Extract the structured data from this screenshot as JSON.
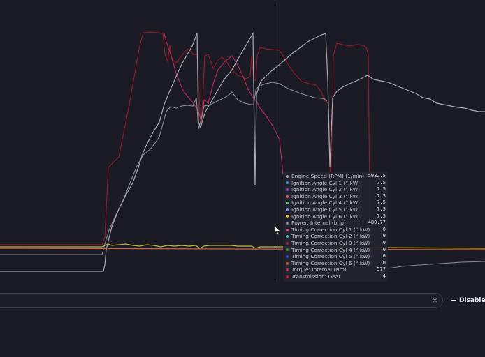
{
  "tooltip": {
    "rows": [
      {
        "label": "Engine Speed (RPM) (1/min)",
        "value": "5932.5",
        "color": "#a0a0aa"
      },
      {
        "label": "Ignition Angle Cyl 1 (° kW)",
        "value": "7.5",
        "color": "#2f8fd8"
      },
      {
        "label": "Ignition Angle Cyl 2 (° kW)",
        "value": "7.5",
        "color": "#9b44d8"
      },
      {
        "label": "Ignition Angle Cyl 3 (° kW)",
        "value": "7.5",
        "color": "#e05a7a"
      },
      {
        "label": "Ignition Angle Cyl 4 (° kW)",
        "value": "7.5",
        "color": "#5cc26a"
      },
      {
        "label": "Ignition Angle Cyl 5 (° kW)",
        "value": "7.5",
        "color": "#6f8ef0"
      },
      {
        "label": "Ignition Angle Cyl 6 (° kW)",
        "value": "7.5",
        "color": "#e8b22c"
      },
      {
        "label": "Power: Internal (bhp)",
        "value": "480.77",
        "color": "#8a8a94"
      },
      {
        "label": "Timing Correction Cyl 1 (° kW)",
        "value": "0",
        "color": "#e0407a"
      },
      {
        "label": "Timing Correction Cyl 2 (° kW)",
        "value": "0",
        "color": "#2fb5b5"
      },
      {
        "label": "Timing Correction Cyl 3 (° kW)",
        "value": "0",
        "color": "#b02050"
      },
      {
        "label": "Timing Correction Cyl 4 (° kW)",
        "value": "0",
        "color": "#3a8a3a"
      },
      {
        "label": "Timing Correction Cyl 5 (° kW)",
        "value": "0",
        "color": "#3a50c8"
      },
      {
        "label": "Timing Correction Cyl 6 (° kW)",
        "value": "0",
        "color": "#c05828"
      },
      {
        "label": "Torque: Internal (Nm)",
        "value": "577",
        "color": "#c0305a"
      },
      {
        "label": "Transmission: Gear",
        "value": "4",
        "color": "#d02030"
      }
    ]
  },
  "filter": {
    "clear_icon": "×",
    "value": ""
  },
  "disable_button": {
    "label": "Disable C"
  },
  "colors": {
    "background": "#1b1b25",
    "rpm": "#a0a0aa",
    "power": "#8a8a94",
    "torque": "#c0305a",
    "gear": "#d02030",
    "ignition": "#e8b22c",
    "timing": "#e05a40"
  }
}
